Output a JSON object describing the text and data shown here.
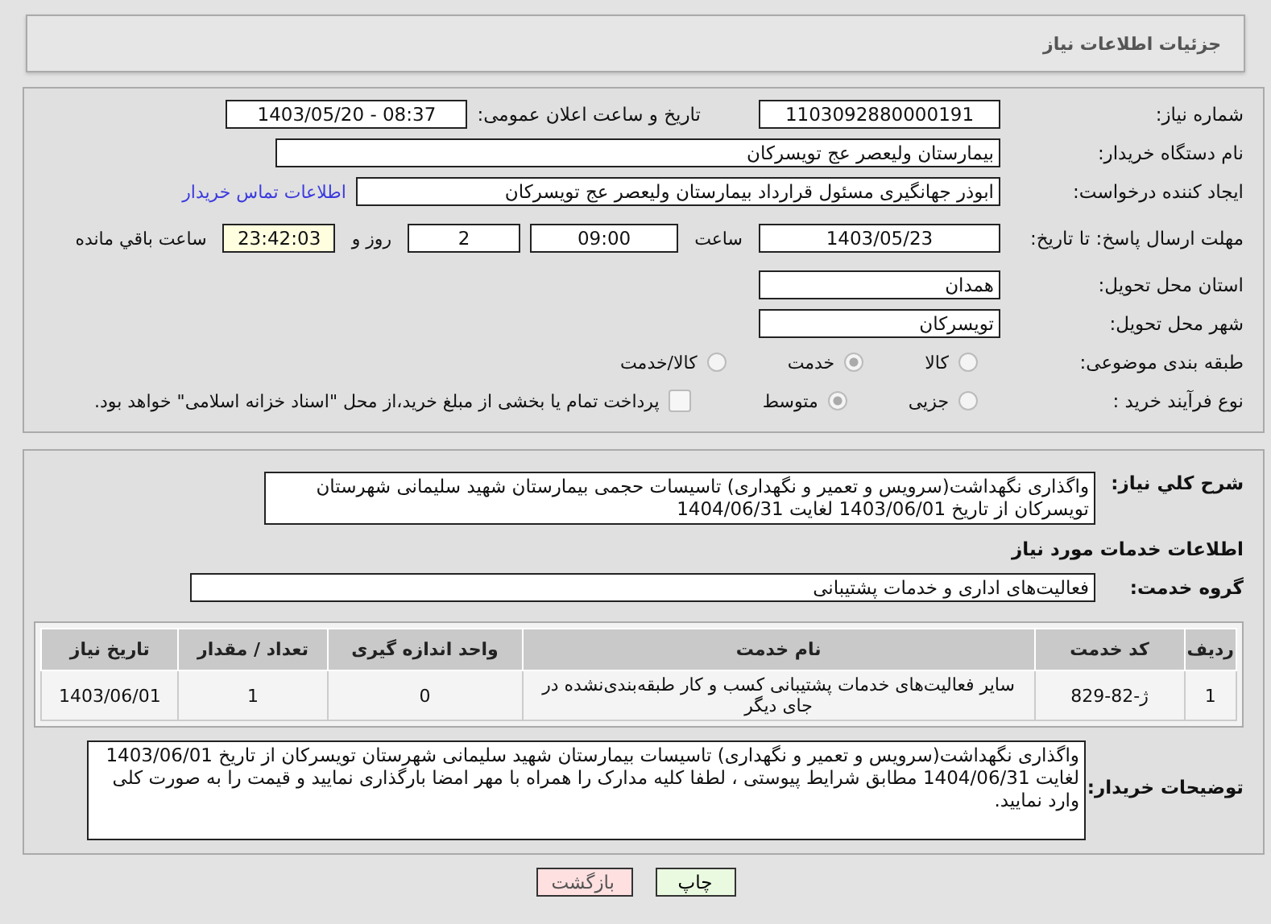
{
  "header": {
    "title": "جزئیات اطلاعات نیاز"
  },
  "form": {
    "need_number": {
      "label": "شماره نیاز:",
      "value": "1103092880000191"
    },
    "announce": {
      "label": "تاریخ و ساعت اعلان عمومی:",
      "value": "1403/05/20 - 08:37"
    },
    "buyer_org": {
      "label": "نام دستگاه خریدار:",
      "value": "بیمارستان ولیعصر  عج  تویسرکان"
    },
    "creator": {
      "label": "ایجاد کننده درخواست:",
      "value": "ابوذر جهانگیری مسئول قرارداد بیمارستان ولیعصر  عج  تویسرکان",
      "link": "اطلاعات تماس خریدار"
    },
    "deadline": {
      "label": "مهلت ارسال پاسخ: تا تاریخ:",
      "date": "1403/05/23",
      "time_label": "ساعت",
      "time": "09:00",
      "days": "2",
      "days_label": "روز و",
      "remaining": "23:42:03",
      "remaining_label": "ساعت باقي مانده"
    },
    "province": {
      "label": "استان محل تحویل:",
      "value": "همدان"
    },
    "city": {
      "label": "شهر محل تحویل:",
      "value": "تویسرکان"
    },
    "category": {
      "label": "طبقه بندی موضوعی:",
      "options": [
        {
          "label": "کالا",
          "selected": false
        },
        {
          "label": "خدمت",
          "selected": true
        },
        {
          "label": "کالا/خدمت",
          "selected": false
        }
      ]
    },
    "process": {
      "label": "نوع فرآیند خرید :",
      "options": [
        {
          "label": "جزیی",
          "selected": false
        },
        {
          "label": "متوسط",
          "selected": true
        }
      ],
      "treasury": {
        "checked": false,
        "text": "پرداخت تمام یا بخشی از مبلغ خرید،از محل \"اسناد خزانه اسلامی\" خواهد بود."
      }
    }
  },
  "details": {
    "summary": {
      "label": "شرح کلي نياز:",
      "value": "واگذاری نگهداشت(سرویس و تعمیر و نگهداری) تاسیسات حجمی بیمارستان شهید سلیمانی شهرستان تویسرکان از تاریخ 1403/06/01 لغایت 1404/06/31"
    },
    "services_heading": "اطلاعات خدمات مورد نیاز",
    "service_group": {
      "label": "گروه خدمت:",
      "value": "فعالیت‌های اداری و خدمات پشتیبانی"
    },
    "table": {
      "columns": [
        "ردیف",
        "کد خدمت",
        "نام خدمت",
        "واحد اندازه گیری",
        "تعداد / مقدار",
        "تاریخ نیاز"
      ],
      "rows": [
        [
          "1",
          "ژ-82-829",
          "سایر فعالیت‌های خدمات پشتیبانی کسب و کار طبقه‌بندی‌نشده در جای دیگر",
          "0",
          "1",
          "1403/06/01"
        ]
      ]
    },
    "buyer_notes": {
      "label": "توضیحات خریدار:",
      "value": "واگذاری نگهداشت(سرویس و تعمیر و نگهداری) تاسیسات بیمارستان شهید سلیمانی شهرستان تویسرکان از تاریخ 1403/06/01 لغایت 1404/06/31 مطابق شرایط پیوستی ، لطفا کلیه مدارک را همراه با مهر امضا بارگذاری نمایید و قیمت را به صورت کلی وارد نمایید."
    }
  },
  "buttons": [
    {
      "kind": "print",
      "label": "چاپ"
    },
    {
      "kind": "back",
      "label": "بازگشت"
    }
  ]
}
